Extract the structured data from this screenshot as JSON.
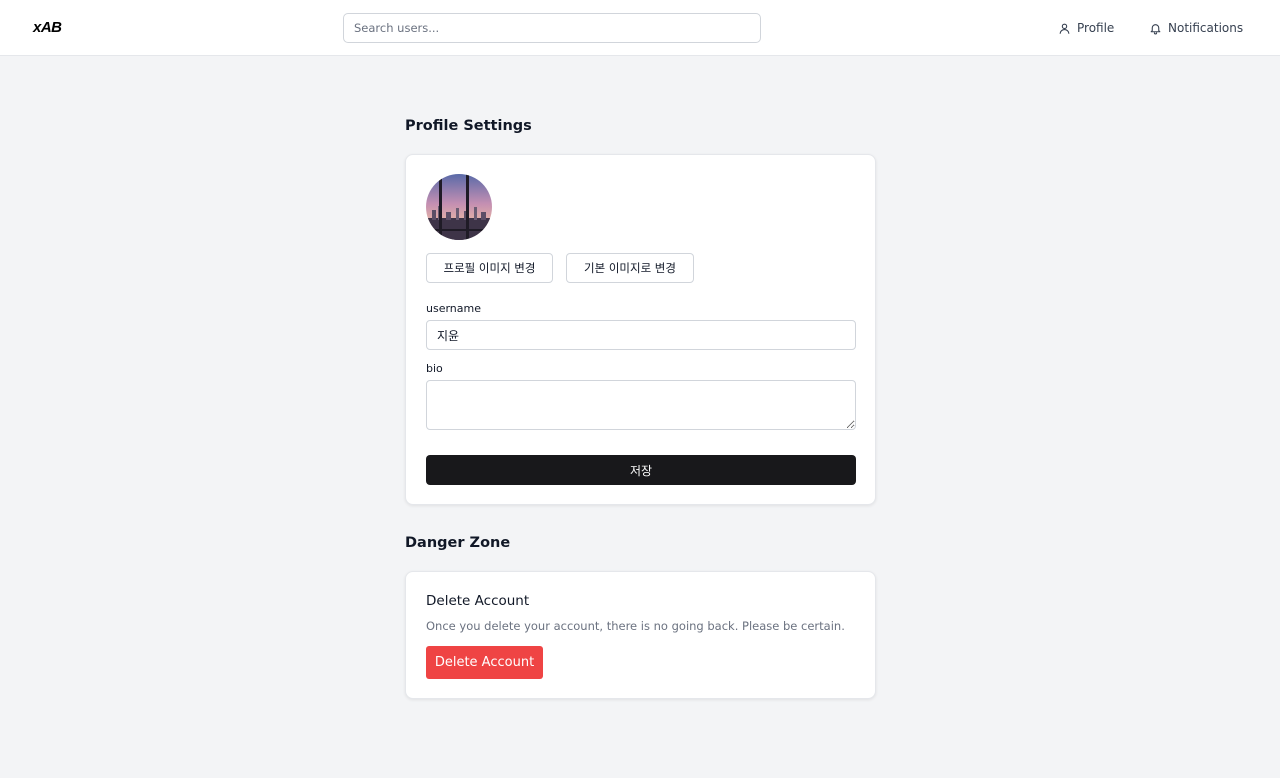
{
  "header": {
    "logo": "xAB",
    "search_placeholder": "Search users...",
    "nav": {
      "profile": {
        "label": "Profile",
        "icon": "user-icon"
      },
      "notifications": {
        "label": "Notifications",
        "icon": "bell-icon"
      }
    }
  },
  "profile_settings": {
    "title": "Profile Settings",
    "avatar": "city-skyline-avatar",
    "change_image_label": "프로필 이미지 변경",
    "default_image_label": "기본 이미지로 변경",
    "username_label": "username",
    "username_value": "지윤",
    "bio_label": "bio",
    "bio_value": "",
    "save_label": "저장"
  },
  "danger_zone": {
    "title": "Danger Zone",
    "heading": "Delete Account",
    "description": "Once you delete your account, there is no going back. Please be certain.",
    "button_label": "Delete Account"
  },
  "colors": {
    "background": "#f3f4f6",
    "primary_button": "#18181b",
    "danger_button": "#ef4444"
  }
}
